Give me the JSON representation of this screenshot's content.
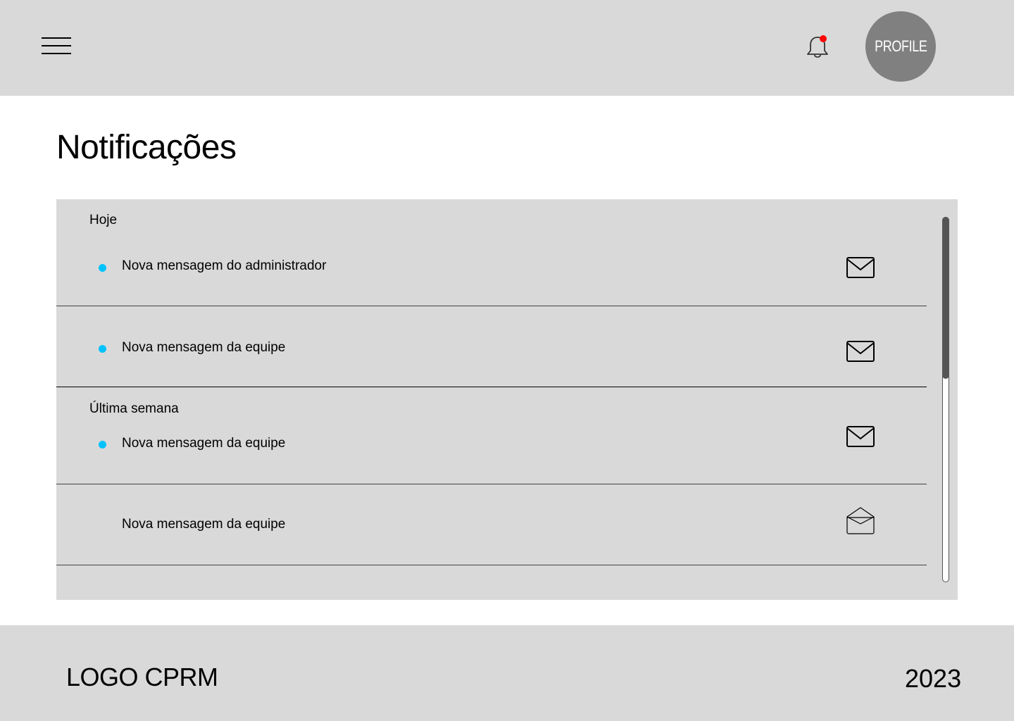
{
  "header": {
    "profile_label": "PROFILE",
    "notification_dot_color": "#ff0000"
  },
  "page": {
    "title": "Notificações"
  },
  "notifications": {
    "groups": [
      {
        "label": "Hoje"
      },
      {
        "label": "Última semana"
      }
    ],
    "items": [
      {
        "text": "Nova mensagem do administrador",
        "unread": true,
        "icon": "envelope-closed-icon"
      },
      {
        "text": "Nova mensagem da equipe",
        "unread": true,
        "icon": "envelope-closed-icon"
      },
      {
        "text": "Nova mensagem da equipe",
        "unread": true,
        "icon": "envelope-closed-icon"
      },
      {
        "text": "Nova mensagem da equipe",
        "unread": false,
        "icon": "envelope-open-icon"
      }
    ],
    "unread_dot_color": "#00c2ff"
  },
  "footer": {
    "logo": "LOGO CPRM",
    "year": "2023"
  }
}
